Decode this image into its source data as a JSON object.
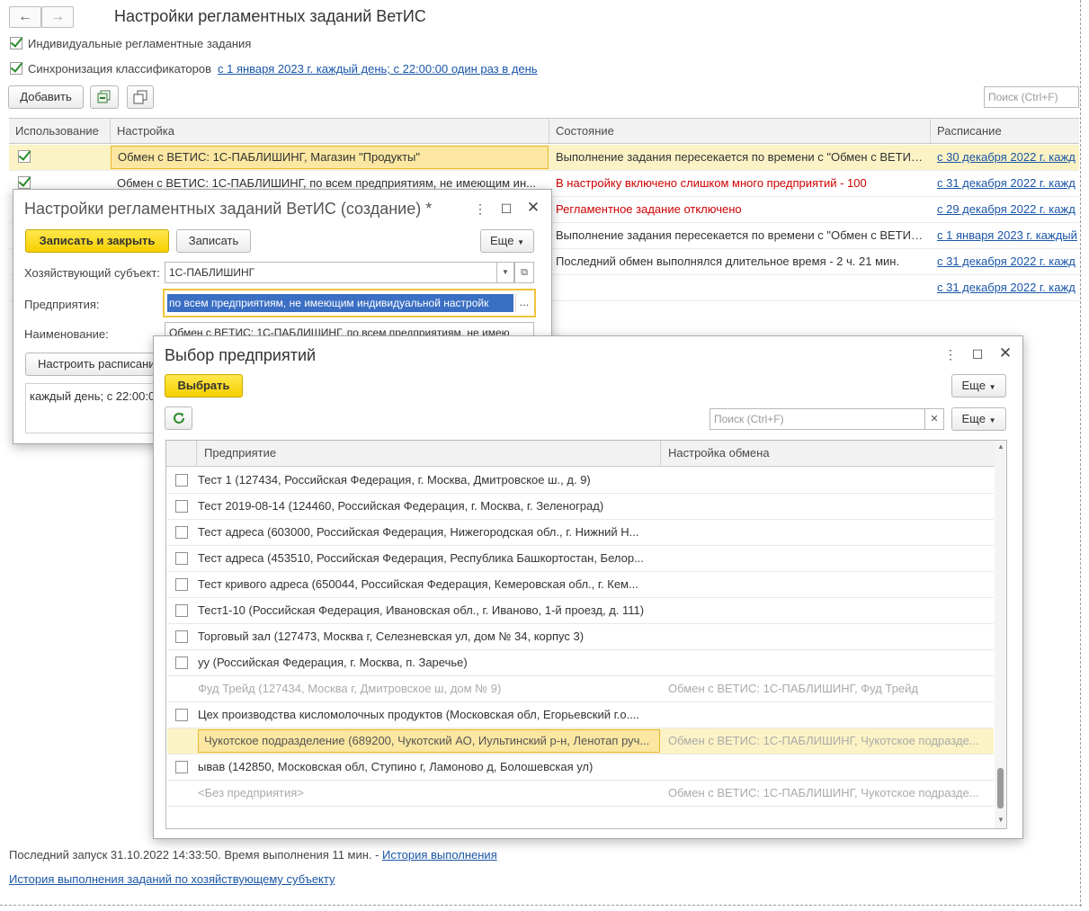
{
  "main": {
    "title": "Настройки регламентных заданий ВетИС",
    "nav_back": "←",
    "nav_forward": "→",
    "check_individual": "Индивидуальные регламентные задания",
    "check_sync": "Синхронизация классификаторов",
    "sync_schedule_link": "с 1 января 2023 г. каждый день; с 22:00:00 один раз в день",
    "add_button": "Добавить",
    "search_placeholder": "Поиск (Ctrl+F)",
    "columns": [
      "Использование",
      "Настройка",
      "Состояние",
      "Расписание"
    ],
    "rows": [
      {
        "checked": true,
        "setting": "Обмен с ВЕТИС: 1С-ПАБЛИШИНГ, Магазин \"Продукты\"",
        "state": "Выполнение задания пересекается по времени с \"Обмен с ВЕТИС:...",
        "state_red": false,
        "schedule": "с 30 декабря 2022 г. кажд"
      },
      {
        "checked": true,
        "setting": "Обмен с ВЕТИС: 1С-ПАБЛИШИНГ, по всем предприятиям, не имеющим ин...",
        "state": "В настройку включено слишком много предприятий - 100",
        "state_red": true,
        "schedule": "с 31 декабря 2022 г. кажд"
      },
      {
        "checked": false,
        "setting": "",
        "state": "Регламентное задание отключено",
        "state_red": true,
        "schedule": "с 29 декабря 2022 г. кажд"
      },
      {
        "checked": false,
        "setting": "",
        "state": "Выполнение задания пересекается по времени с \"Обмен с ВЕТИС:...",
        "state_red": false,
        "schedule": "с 1 января 2023 г. каждый"
      },
      {
        "checked": false,
        "setting": "",
        "state": "Последний обмен выполнялся длительное время - 2 ч. 21 мин.",
        "state_red": false,
        "schedule": "с 31 декабря 2022 г. кажд"
      },
      {
        "checked": false,
        "setting": "",
        "state": "",
        "state_red": false,
        "schedule": "с 31 декабря 2022 г. кажд"
      }
    ],
    "last_run_text": "Последний запуск 31.10.2022 14:33:50. Время выполнения 11 мин. -",
    "history_link": "История выполнения",
    "history_by_entity_link": "История выполнения заданий по хозяйствующему субъекту"
  },
  "create_dialog": {
    "title": "Настройки регламентных заданий ВетИС (создание) *",
    "save_close_button": "Записать и закрыть",
    "save_button": "Записать",
    "more_button": "Еще",
    "entity_label": "Хозяйствующий субъект:",
    "entity_value": "1С-ПАБЛИШИНГ",
    "enterprises_label": "Предприятия:",
    "enterprises_value": "по всем предприятиям, не имеющим индивидуальной настройк",
    "name_label": "Наименование:",
    "name_value": "Обмен с ВЕТИС: 1С-ПАБЛИШИНГ, по всем предприятиям, не имею",
    "schedule_button": "Настроить расписание",
    "schedule_text": "каждый день; с 22:00:0"
  },
  "select_dialog": {
    "title": "Выбор предприятий",
    "select_button": "Выбрать",
    "more_button_top": "Еще",
    "more_button": "Еще",
    "search_placeholder": "Поиск (Ctrl+F)",
    "col_enterprise": "Предприятие",
    "col_exchange": "Настройка обмена",
    "rows": [
      {
        "checkbox": true,
        "enterprise": "Тест 1 (127434, Российская Федерация, г. Москва, Дмитровское ш., д. 9)",
        "exchange": "",
        "grey": false,
        "selected": false
      },
      {
        "checkbox": true,
        "enterprise": "Тест 2019-08-14 (124460, Российская Федерация, г. Москва, г. Зеленоград)",
        "exchange": "",
        "grey": false,
        "selected": false
      },
      {
        "checkbox": true,
        "enterprise": "Тест адреса (603000, Российская Федерация, Нижегородская обл., г. Нижний Н...",
        "exchange": "",
        "grey": false,
        "selected": false
      },
      {
        "checkbox": true,
        "enterprise": "Тест адреса (453510, Российская Федерация, Республика Башкортостан, Белор...",
        "exchange": "",
        "grey": false,
        "selected": false
      },
      {
        "checkbox": true,
        "enterprise": "Тест кривого адреса (650044, Российская Федерация, Кемеровская обл., г. Кем...",
        "exchange": "",
        "grey": false,
        "selected": false
      },
      {
        "checkbox": true,
        "enterprise": "Тест1-10 (Российская Федерация, Ивановская обл., г. Иваново, 1-й проезд, д. 111)",
        "exchange": "",
        "grey": false,
        "selected": false
      },
      {
        "checkbox": true,
        "enterprise": "Торговый зал (127473, Москва г, Селезневская ул, дом № 34, корпус 3)",
        "exchange": "",
        "grey": false,
        "selected": false
      },
      {
        "checkbox": true,
        "enterprise": "уу (Российская Федерация, г. Москва, п. Заречье)",
        "exchange": "",
        "grey": false,
        "selected": false
      },
      {
        "checkbox": false,
        "enterprise": "Фуд Трейд (127434, Москва г, Дмитровское ш, дом № 9)",
        "exchange": "Обмен с ВЕТИС: 1С-ПАБЛИШИНГ, Фуд Трейд",
        "grey": true,
        "selected": false
      },
      {
        "checkbox": true,
        "enterprise": "Цех производства кисломолочных продуктов (Московская обл, Егорьевский г.о....",
        "exchange": "",
        "grey": false,
        "selected": false
      },
      {
        "checkbox": false,
        "enterprise": "Чукотское подразделение (689200, Чукотский АО, Иультинский р-н, Ленотап руч...",
        "exchange": "Обмен с ВЕТИС: 1С-ПАБЛИШИНГ, Чукотское подразде...",
        "grey": true,
        "selected": true
      },
      {
        "checkbox": true,
        "enterprise": "ывав (142850, Московская обл, Ступино г, Ламоново д, Болошевская ул)",
        "exchange": "",
        "grey": false,
        "selected": false
      },
      {
        "checkbox": false,
        "enterprise": "<Без предприятия>",
        "exchange": "Обмен с ВЕТИС: 1С-ПАБЛИШИНГ, Чукотское подразде...",
        "grey": true,
        "selected": false
      }
    ]
  },
  "colors": {
    "link": "#1a56a8",
    "error": "#d00000",
    "accent_yellow": "#f6d000",
    "selection": "#fbf3c5"
  }
}
